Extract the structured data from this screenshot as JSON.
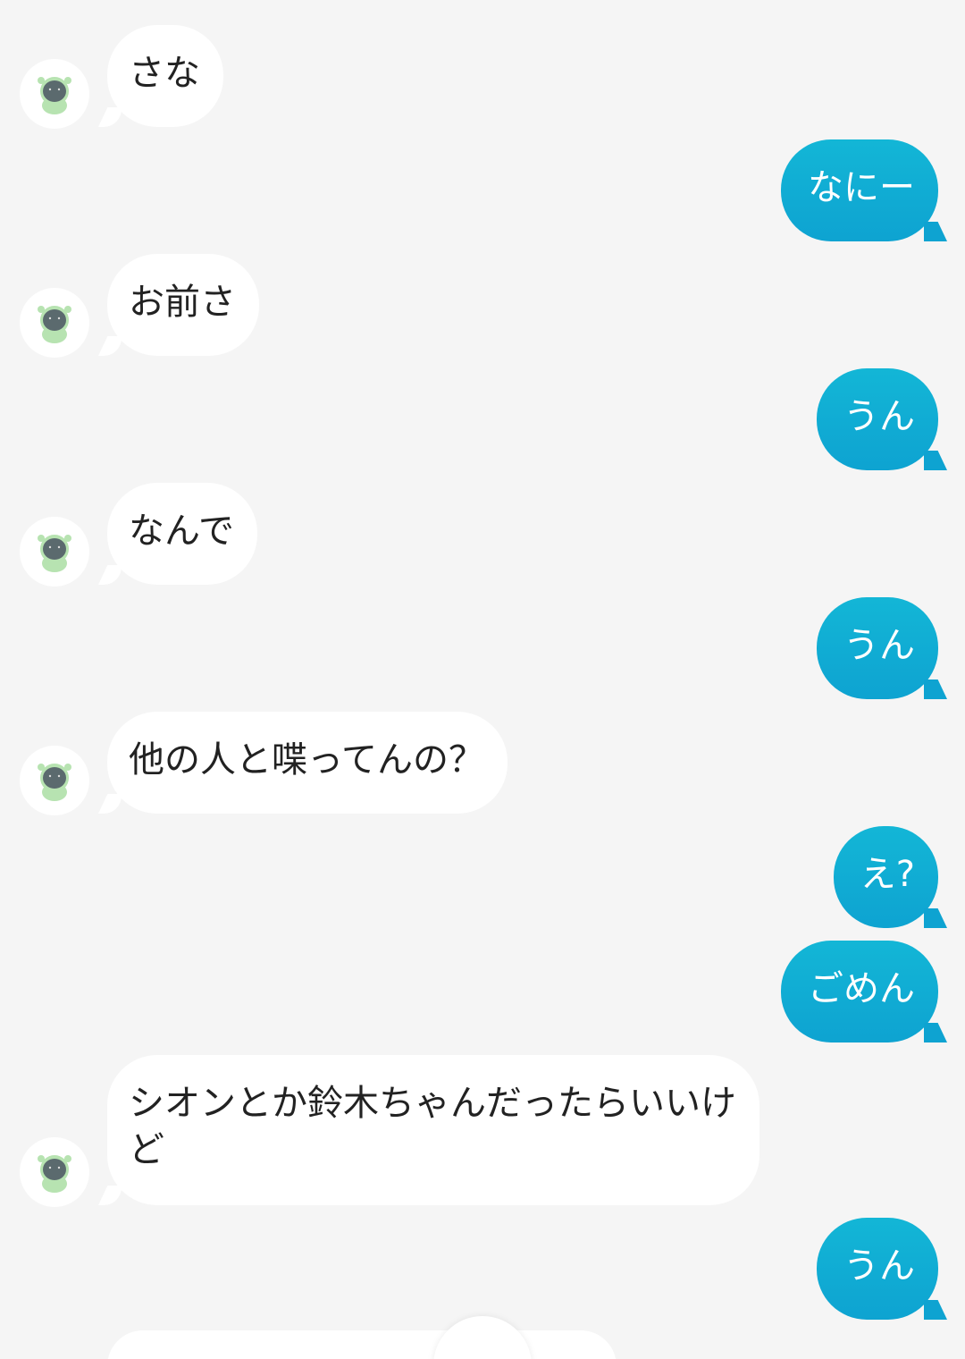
{
  "header": {
    "partial_title": ""
  },
  "messages": [
    {
      "side": "in",
      "text": "さな"
    },
    {
      "side": "out",
      "text": "なにー"
    },
    {
      "side": "in",
      "text": "お前さ"
    },
    {
      "side": "out",
      "text": "うん"
    },
    {
      "side": "in",
      "text": "なんで"
    },
    {
      "side": "out",
      "text": "うん"
    },
    {
      "side": "in",
      "text": "他の人と喋ってんの？"
    },
    {
      "side": "out",
      "text": "え?"
    },
    {
      "side": "out",
      "text": "ごめん"
    },
    {
      "side": "in",
      "text": "シオンとか鈴木ちゃんだったらいいけど"
    },
    {
      "side": "out",
      "text": "うん"
    }
  ],
  "colors": {
    "background": "#f5f5f5",
    "incoming_bubble": "#ffffff",
    "outgoing_bubble": "#0ea3d1"
  },
  "icons": {
    "avatar": "sheep-character-avatar-icon",
    "scroll_down": "scroll-down-button"
  }
}
